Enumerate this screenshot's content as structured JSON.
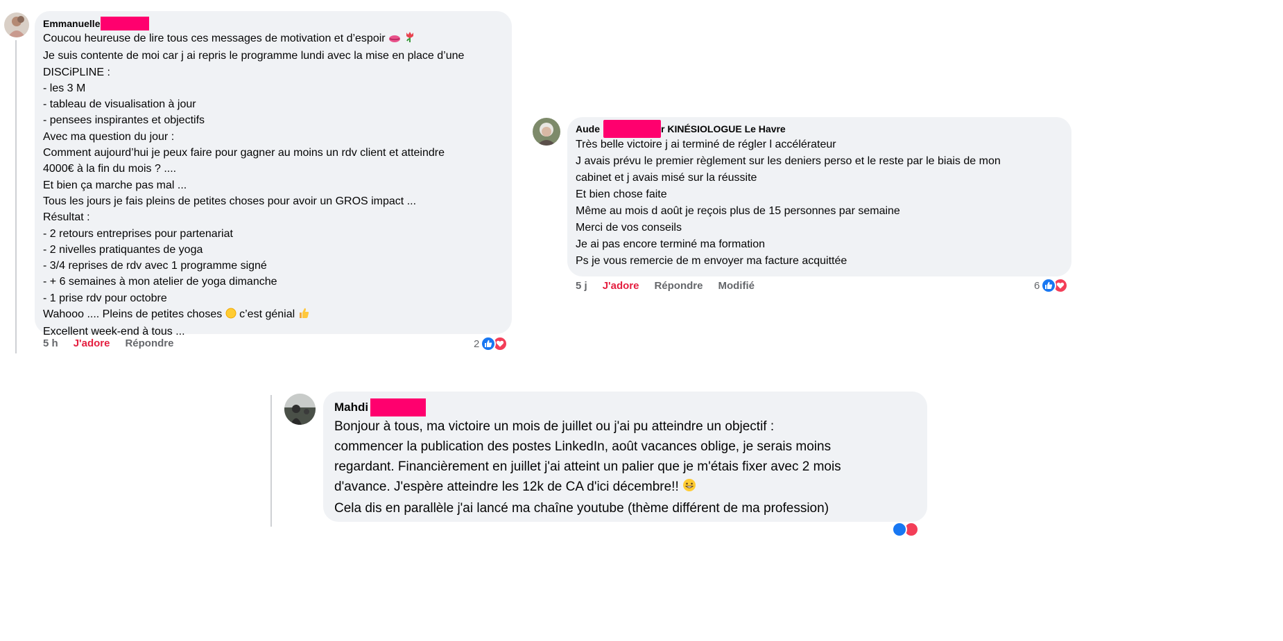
{
  "comments": [
    {
      "author": "Emmanuelle",
      "lines": [
        "Coucou heureuse de lire tous ces messages de motivation et d’espoir",
        "Je suis contente de moi car j ai repris le programme lundi avec la mise en place d’une",
        "DISCiPLINE :",
        "- les 3 M",
        "- tableau de visualisation à jour",
        "- pensees inspirantes et objectifs",
        "Avec ma question du jour :",
        "Comment aujourd’hui je peux faire pour gagner au moins un rdv client et atteindre",
        "4000€ à la fin du mois ? ....",
        "Et bien ça marche pas mal ...",
        "Tous les jours je fais pleins de petites choses pour avoir un GROS impact ...",
        "Résultat :",
        "- 2 retours entreprises pour partenariat",
        "- 2 nivelles pratiquantes de yoga",
        "- 3/4 reprises de rdv avec 1 programme signé",
        "- + 6 semaines à mon atelier de yoga dimanche",
        "- 1 prise rdv pour octobre",
        "Wahooo .... Pleins de petites choses",
        "c’est génial",
        "Excellent week-end à tous ..."
      ],
      "time": "5 h",
      "love_label": "J'adore",
      "reply_label": "Répondre",
      "reaction_count": "2",
      "avatar_icon": "user-avatar-photo-icon"
    },
    {
      "author": "Aude",
      "author_suffix": "r KINÉSIOLOGUE Le Havre",
      "lines": [
        "Très belle victoire j ai terminé de régler l accélérateur",
        "J avais prévu le premier règlement sur les deniers perso et le reste par le biais de mon",
        "cabinet et j avais misé sur la réussite",
        "Et bien chose faite",
        "Même au mois d août je reçois plus de 15 personnes par semaine",
        "Merci de vos conseils",
        "Je ai pas encore terminé ma formation",
        "Ps je vous remercie de m envoyer ma facture acquittée"
      ],
      "time": "5 j",
      "love_label": "J'adore",
      "reply_label": "Répondre",
      "edited_label": "Modifié",
      "reaction_count": "6",
      "avatar_icon": "user-avatar-photo-icon"
    },
    {
      "author": "Mahdi",
      "lines": [
        "Bonjour à tous, ma victoire un mois de juillet ou j'ai pu atteindre un objectif :",
        "commencer la publication des postes LinkedIn, août vacances oblige, je serais moins",
        "regardant. Financièrement en juillet j'ai atteint un palier que je m'étais fixer avec 2 mois",
        "d'avance. J'espère atteindre les 12k de CA d'ici décembre!!",
        "Cela dis en parallèle j'ai lancé ma chaîne youtube (thème différent de ma profession)"
      ],
      "avatar_icon": "user-avatar-photo-icon"
    }
  ],
  "icons": {
    "like": "like-reaction-icon",
    "love": "love-reaction-icon",
    "emoji_lips": "lips-emoji-icon",
    "emoji_tulip": "tulip-emoji-icon",
    "emoji_sun": "sun-emoji-icon",
    "emoji_thumb": "thumbs-up-emoji-icon",
    "emoji_grin": "grinning-emoji-icon"
  },
  "colors": {
    "bubble": "#f0f2f5",
    "redaction": "#ff006e",
    "love": "#e41e3f",
    "like_badge": "#1877f2",
    "love_badge": "#f33e58"
  }
}
